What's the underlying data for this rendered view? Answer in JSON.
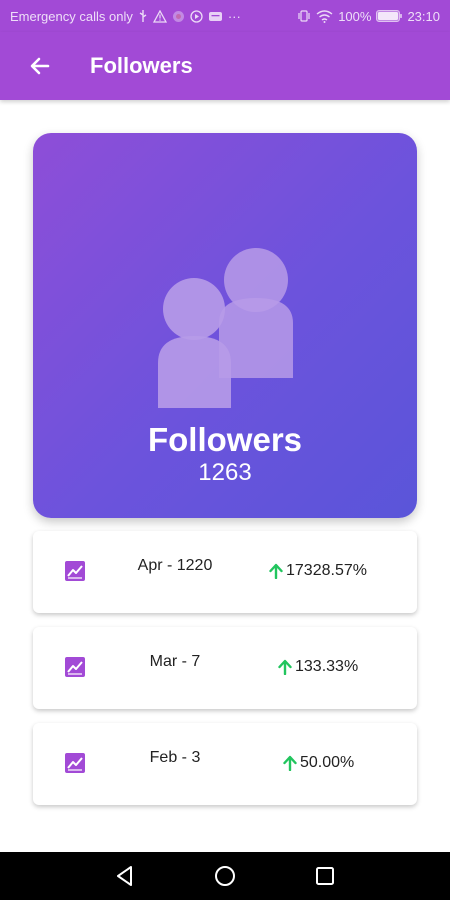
{
  "status_bar": {
    "carrier_text": "Emergency calls only",
    "more_dots": "···",
    "battery_percent": "100%",
    "time": "23:10"
  },
  "app_bar": {
    "title": "Followers"
  },
  "summary": {
    "title": "Followers",
    "count": "1263"
  },
  "history": [
    {
      "label": "Apr - 1220",
      "change": "17328.57%"
    },
    {
      "label": "Mar - 7",
      "change": "133.33%"
    },
    {
      "label": "Feb - 3",
      "change": "50.00%"
    }
  ],
  "colors": {
    "primary": "#a24ad6",
    "card_gradient_start": "#8e4ed8",
    "card_gradient_end": "#5a55d9",
    "positive": "#22c55e"
  },
  "icons": {
    "back": "arrow-left-icon",
    "hero": "people-icon",
    "row": "trending-chart-icon",
    "trend": "arrow-up-icon"
  }
}
